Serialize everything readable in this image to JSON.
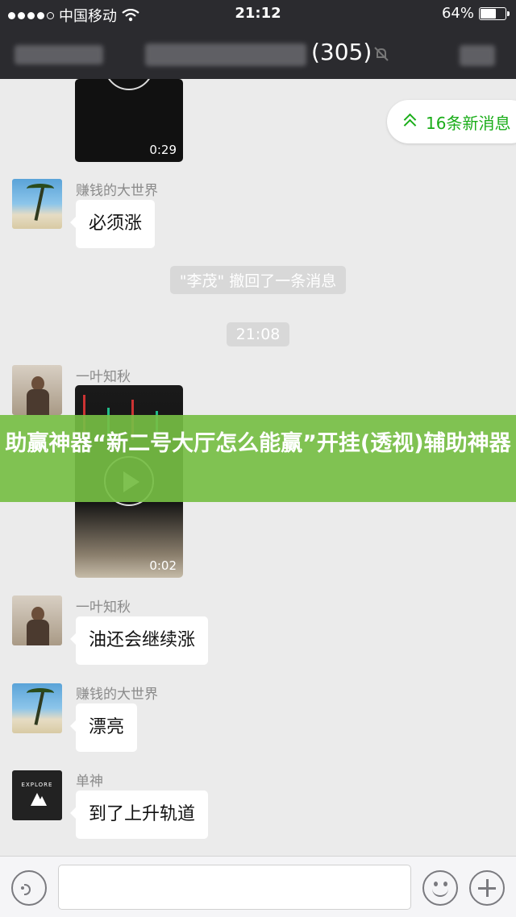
{
  "status_bar": {
    "carrier": "中国移动",
    "time": "21:12",
    "battery": "64%",
    "battery_level": 0.64
  },
  "header": {
    "title_count": "(305)",
    "mute_icon": "mute-bell-icon"
  },
  "new_messages": {
    "label": "16条新消息",
    "icon": "double-chevron-up-icon"
  },
  "messages": [
    {
      "type": "video",
      "duration": "0:29"
    },
    {
      "type": "text",
      "sender": "赚钱的大世界",
      "text": "必须涨",
      "avatar": "beach-avatar"
    },
    {
      "type": "system",
      "text": "\"李茂\" 撤回了一条消息"
    },
    {
      "type": "timestamp",
      "text": "21:08"
    },
    {
      "type": "video",
      "sender": "一叶知秋",
      "duration": "0:02",
      "avatar": "person-avatar"
    },
    {
      "type": "text",
      "sender": "一叶知秋",
      "text": "油还会继续涨",
      "avatar": "person-avatar"
    },
    {
      "type": "text",
      "sender": "赚钱的大世界",
      "text": "漂亮",
      "avatar": "beach-avatar"
    },
    {
      "type": "text",
      "sender": "单神",
      "text": "到了上升轨道",
      "avatar": "explore-avatar",
      "avatar_text": "EXPLORE"
    }
  ],
  "banner": {
    "text": "助赢神器“新二号大厅怎么能赢”开挂(透视)辅助神器"
  },
  "input_bar": {
    "voice_icon": "voice-icon",
    "emoji_icon": "emoji-icon",
    "plus_icon": "plus-icon",
    "message_value": ""
  },
  "colors": {
    "header_bg": "#2b2b2f",
    "chat_bg": "#ebebeb",
    "accent_green": "#1aad19",
    "banner_green": "#76be44"
  }
}
